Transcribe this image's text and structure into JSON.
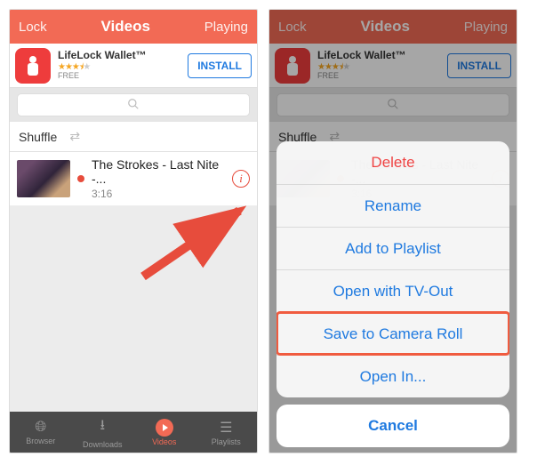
{
  "colors": {
    "accent": "#f26a55",
    "link": "#1f7ae0",
    "destructive": "#ef4444"
  },
  "header": {
    "left": "Lock",
    "title": "Videos",
    "right": "Playing"
  },
  "ad": {
    "title": "LifeLock Wallet™",
    "rating_stars": 3.5,
    "price_label": "FREE",
    "cta": "INSTALL",
    "icon_name": "lifelock-person-icon"
  },
  "search": {
    "placeholder": "",
    "icon": "search-icon"
  },
  "shuffle": {
    "label": "Shuffle",
    "icon": "shuffle-icon"
  },
  "videos": [
    {
      "title": "The Strokes - Last Nite -...",
      "duration": "3:16",
      "now_playing": true
    }
  ],
  "tabs": [
    {
      "id": "browser",
      "label": "Browser",
      "icon": "globe-icon",
      "active": false
    },
    {
      "id": "downloads",
      "label": "Downloads",
      "icon": "download-icon",
      "active": false
    },
    {
      "id": "videos",
      "label": "Videos",
      "icon": "play-icon",
      "active": true
    },
    {
      "id": "playlists",
      "label": "Playlists",
      "icon": "list-icon",
      "active": false
    }
  ],
  "action_sheet": {
    "items": [
      {
        "label": "Delete",
        "destructive": true,
        "highlight": false
      },
      {
        "label": "Rename",
        "destructive": false,
        "highlight": false
      },
      {
        "label": "Add to Playlist",
        "destructive": false,
        "highlight": false
      },
      {
        "label": "Open with TV-Out",
        "destructive": false,
        "highlight": false
      },
      {
        "label": "Save to Camera Roll",
        "destructive": false,
        "highlight": true
      },
      {
        "label": "Open In...",
        "destructive": false,
        "highlight": false
      }
    ],
    "cancel": "Cancel"
  }
}
